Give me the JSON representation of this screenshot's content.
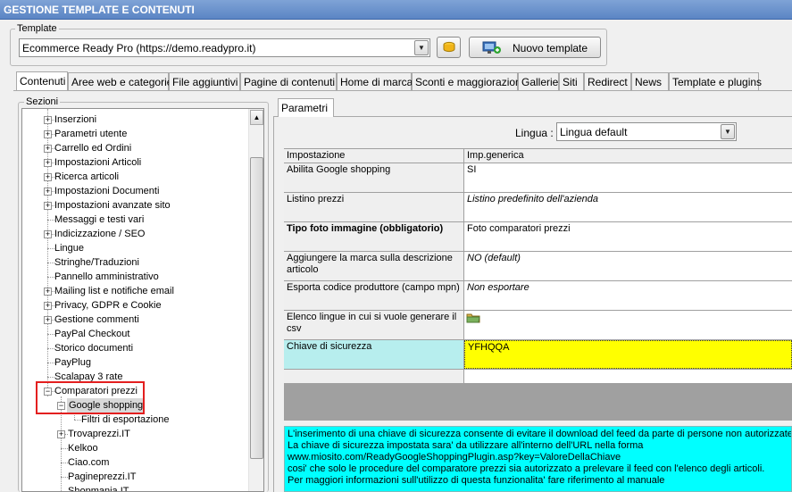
{
  "window": {
    "title": "GESTIONE TEMPLATE E CONTENUTI"
  },
  "template": {
    "label": "Template",
    "selected": "Ecommerce Ready Pro (https://demo.readypro.it)",
    "new_button": "Nuovo template"
  },
  "tabs": [
    {
      "label": "Contenuti"
    },
    {
      "label": "Aree web e categorie"
    },
    {
      "label": "File aggiuntivi"
    },
    {
      "label": "Pagine di contenuti"
    },
    {
      "label": "Home di marca"
    },
    {
      "label": "Sconti e maggiorazioni"
    },
    {
      "label": "Gallerie"
    },
    {
      "label": "Siti"
    },
    {
      "label": "Redirect"
    },
    {
      "label": "News"
    },
    {
      "label": "Template e plugins"
    }
  ],
  "sections": {
    "label": "Sezioni",
    "items": [
      {
        "label": "Inserzioni"
      },
      {
        "label": "Parametri utente"
      },
      {
        "label": "Carrello ed Ordini"
      },
      {
        "label": "Impostazioni Articoli"
      },
      {
        "label": "Ricerca articoli"
      },
      {
        "label": "Impostazioni Documenti"
      },
      {
        "label": "Impostazioni avanzate sito"
      },
      {
        "label": "Messaggi e testi vari"
      },
      {
        "label": "Indicizzazione / SEO"
      },
      {
        "label": "Lingue"
      },
      {
        "label": "Stringhe/Traduzioni"
      },
      {
        "label": "Pannello amministrativo"
      },
      {
        "label": "Mailing list e notifiche email"
      },
      {
        "label": "Privacy, GDPR e Cookie"
      },
      {
        "label": "Gestione commenti"
      },
      {
        "label": "PayPal Checkout"
      },
      {
        "label": "Storico documenti"
      },
      {
        "label": "PayPlug"
      },
      {
        "label": "Scalapay 3 rate"
      },
      {
        "label": "Comparatori prezzi"
      },
      {
        "label": "Google shopping"
      },
      {
        "label": "Filtri di esportazione"
      },
      {
        "label": "Trovaprezzi.IT"
      },
      {
        "label": "Kelkoo"
      },
      {
        "label": "Ciao.com"
      },
      {
        "label": "Pagineprezzi.IT"
      },
      {
        "label": "Shopmania.IT"
      }
    ]
  },
  "params": {
    "tab": "Parametri",
    "lingua_label": "Lingua :",
    "lingua_value": "Lingua default",
    "header": {
      "key": "Impostazione",
      "value": "Imp.generica"
    },
    "rows": [
      {
        "key": "Abilita Google shopping",
        "value": "SI"
      },
      {
        "key": "Listino prezzi",
        "value": "Listino predefinito dell'azienda"
      },
      {
        "key": "Tipo foto immagine (obbligatorio)",
        "value": "Foto comparatori prezzi"
      },
      {
        "key": "Aggiungere la marca sulla descrizione articolo",
        "value": "NO (default)"
      },
      {
        "key": "Esporta codice produttore (campo mpn)",
        "value": "Non esportare"
      },
      {
        "key": "Elenco lingue in cui si vuole generare il csv",
        "value": ""
      },
      {
        "key": "Chiave di sicurezza",
        "value": "YFHQQA"
      },
      {
        "key": "",
        "value": ""
      }
    ]
  },
  "info": {
    "lines": [
      "L'inserimento di una chiave di sicurezza consente di evitare il download del feed da parte di persone non autorizzate.",
      "La chiave di sicurezza impostata sara' da utilizzare all'interno dell'URL nella forma",
      "www.miosito.com/ReadyGoogleShoppingPlugin.asp?key=ValoreDellaChiave",
      "cosi' che solo le procedure del comparatore prezzi sia autorizzato a prelevare il feed con l'elenco degli articoli.",
      "Per maggiori informazioni sull'utilizzo di questa funzionalita' fare riferimento al manuale"
    ]
  },
  "colors": {
    "title_bar": "#5b85c4",
    "selected_row": "#b7eeee",
    "key_field": "#ffff00",
    "info_background": "#00ffff",
    "highlight_border": "#e31f1f"
  }
}
